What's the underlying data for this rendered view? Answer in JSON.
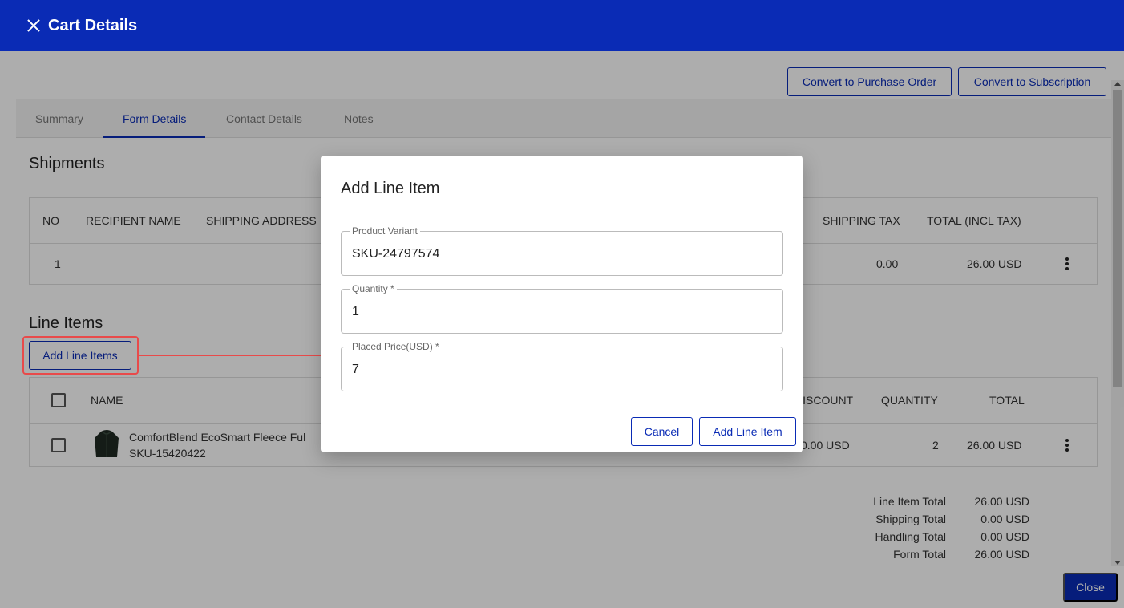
{
  "header": {
    "title": "Cart Details"
  },
  "actions": {
    "convert_po": "Convert to Purchase Order",
    "convert_sub": "Convert to Subscription"
  },
  "tabs": [
    {
      "label": "Summary"
    },
    {
      "label": "Form Details"
    },
    {
      "label": "Contact Details"
    },
    {
      "label": "Notes"
    }
  ],
  "shipments": {
    "title": "Shipments",
    "columns": [
      "NO",
      "RECIPIENT NAME",
      "SHIPPING ADDRESS",
      "SHIPPING TAX",
      "TOTAL (INCL TAX)"
    ],
    "rows": [
      {
        "no": "1",
        "shipping_tax": "0.00",
        "total": "26.00 USD"
      }
    ]
  },
  "line_items": {
    "title": "Line Items",
    "add_button": "Add Line Items",
    "columns": [
      "NAME",
      "DISCOUNT",
      "QUANTITY",
      "TOTAL"
    ],
    "rows": [
      {
        "name": "ComfortBlend EcoSmart Fleece Ful",
        "sku": "SKU-15420422",
        "discount": "0.00 USD",
        "quantity": "2",
        "total": "26.00 USD"
      }
    ]
  },
  "totals": [
    {
      "label": "Line Item Total",
      "value": "26.00 USD"
    },
    {
      "label": "Shipping Total",
      "value": "0.00 USD"
    },
    {
      "label": "Handling Total",
      "value": "0.00 USD"
    },
    {
      "label": "Form Total",
      "value": "26.00 USD"
    }
  ],
  "footer": {
    "close": "Close"
  },
  "dialog": {
    "title": "Add Line Item",
    "fields": [
      {
        "label": "Product Variant",
        "value": "SKU-24797574"
      },
      {
        "label": "Quantity *",
        "value": "1"
      },
      {
        "label": "Placed Price(USD) *",
        "value": "7"
      }
    ],
    "cancel": "Cancel",
    "submit": "Add Line Item"
  },
  "colors": {
    "primary": "#0a2bb5",
    "highlight": "#e84a4a"
  }
}
